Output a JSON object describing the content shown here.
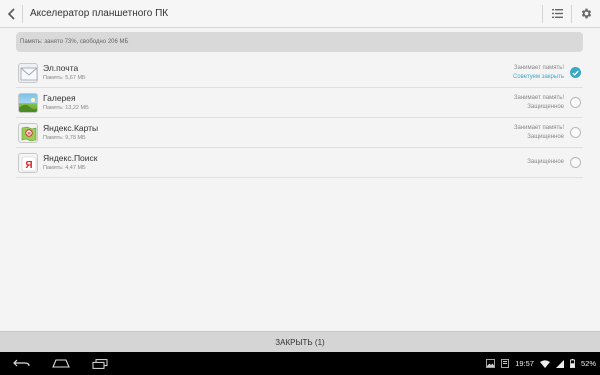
{
  "header": {
    "title": "Акселератор планшетного ПК",
    "back_icon": "back-arrow-icon",
    "list_icon": "list-icon",
    "settings_icon": "gear-icon"
  },
  "memory": {
    "text": "Память: занято 73%, свободно 206 МБ"
  },
  "apps": [
    {
      "name": "Эл.почта",
      "memory": "Память: 5,67 МБ",
      "status": "Занимает память!",
      "note": "Советуем закрыть",
      "checked": true,
      "icon": "mail-icon"
    },
    {
      "name": "Галерея",
      "memory": "Память: 13,22 МБ",
      "status": "Занимает память!",
      "note": "Защищенное",
      "checked": false,
      "icon": "gallery-icon"
    },
    {
      "name": "Яндекс.Карты",
      "memory": "Память: 9,78 МБ",
      "status": "Занимает память!",
      "note": "Защищенное",
      "checked": false,
      "icon": "yandex-maps-icon"
    },
    {
      "name": "Яндекс.Поиск",
      "memory": "Память: 4,47 МБ",
      "status": "",
      "note": "Защищенное",
      "checked": false,
      "icon": "yandex-search-icon"
    }
  ],
  "close_button": {
    "label": "ЗАКРЫТЬ (1)"
  },
  "navbar": {
    "back_icon": "nav-back-icon",
    "home_icon": "nav-home-icon",
    "recents_icon": "nav-recents-icon",
    "time": "19:57",
    "battery": "52%"
  },
  "colors": {
    "accent": "#3aa7c7",
    "header_bg": "#f6f6f6",
    "bar_bg": "#d5d5d5"
  }
}
